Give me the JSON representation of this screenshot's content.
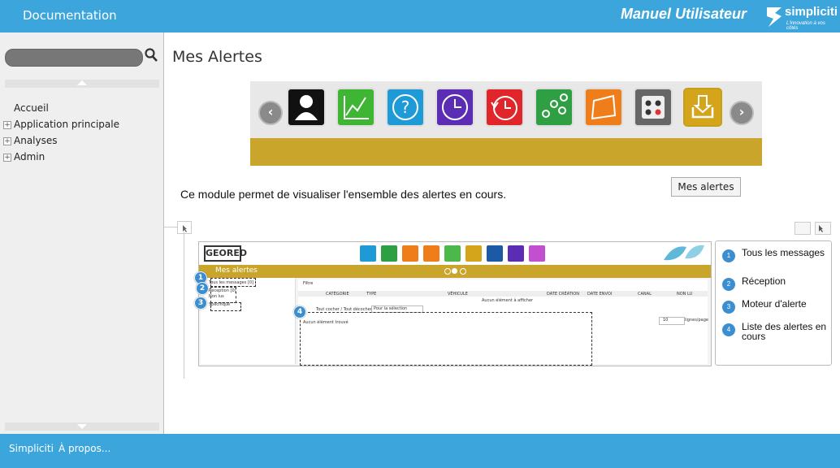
{
  "header": {
    "title": "Documentation",
    "manual": "Manuel Utilisateur",
    "brand": "simpliciti",
    "tagline": "L'innovation à vos côtés"
  },
  "sidebar": {
    "items": [
      {
        "label": "Accueil",
        "expandable": false
      },
      {
        "label": "Application principale",
        "expandable": true
      },
      {
        "label": "Analyses",
        "expandable": true
      },
      {
        "label": "Admin",
        "expandable": true
      }
    ]
  },
  "main": {
    "title": "Mes Alertes",
    "tooltip": "Mes alertes",
    "description": "Ce module permet de visualiser l'ensemble des alertes en cours.",
    "carousel_arrows": {
      "prev": "‹",
      "next": "›"
    }
  },
  "screenshot": {
    "logo": "GEORED",
    "bar_title": "Mes alertes",
    "left_items": [
      "Tous les messages [0]",
      "Réception [0]",
      "Non lus",
      "Spécifique"
    ],
    "filter_label": "Filtre",
    "columns": [
      "CATÉGORIE",
      "TYPE",
      "VÉHICULE",
      "DATE CRÉATION",
      "DATE ENVOI",
      "CANAL",
      "NON LU"
    ],
    "empty_table": "Aucun élément à afficher",
    "check_all": "Tout cocher / Tout décocher",
    "selection": "Pour la sélection",
    "empty_list": "Aucun élément trouvé",
    "page_size": "10",
    "per_page": "lignes/page",
    "markers": [
      "1",
      "2",
      "3",
      "4"
    ]
  },
  "legend": {
    "items": [
      {
        "num": "1",
        "text": "Tous les messages"
      },
      {
        "num": "2",
        "text": "Réception"
      },
      {
        "num": "3",
        "text": "Moteur d'alerte"
      },
      {
        "num": "4",
        "text": "Liste des alertes en cours"
      }
    ]
  },
  "footer": {
    "brand": "Simpliciti",
    "about": "À propos..."
  },
  "colors": {
    "header": "#3ca6dc",
    "gold": "#c9a52c",
    "badge": "#3b8fd0"
  }
}
